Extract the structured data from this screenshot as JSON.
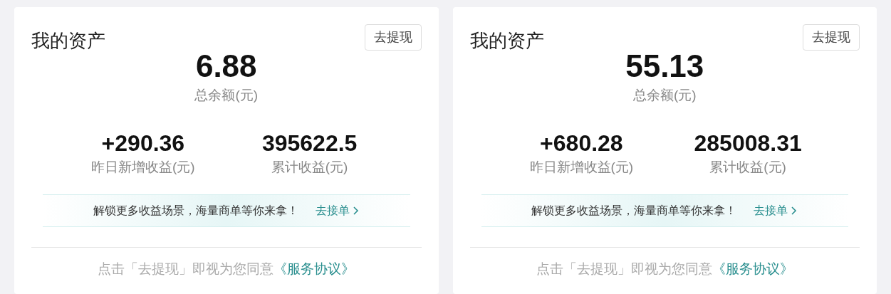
{
  "cards": [
    {
      "title": "我的资产",
      "withdraw_button": "去提现",
      "balance": "6.88",
      "balance_label": "总余额(元)",
      "stats": [
        {
          "value": "+290.36",
          "label": "昨日新增收益(元)"
        },
        {
          "value": "395622.5",
          "label": "累计收益(元)"
        }
      ],
      "banner": {
        "text": "解锁更多收益场景，海量商单等你来拿！",
        "link": "去接单"
      },
      "footer": {
        "text": "点击「去提现」即视为您同意",
        "link": "《服务协议》"
      }
    },
    {
      "title": "我的资产",
      "withdraw_button": "去提现",
      "balance": "55.13",
      "balance_label": "总余额(元)",
      "stats": [
        {
          "value": "+680.28",
          "label": "昨日新增收益(元)"
        },
        {
          "value": "285008.31",
          "label": "累计收益(元)"
        }
      ],
      "banner": {
        "text": "解锁更多收益场景，海量商单等你来拿！",
        "link": "去接单"
      },
      "footer": {
        "text": "点击「去提现」即视为您同意",
        "link": "《服务协议》"
      }
    }
  ]
}
